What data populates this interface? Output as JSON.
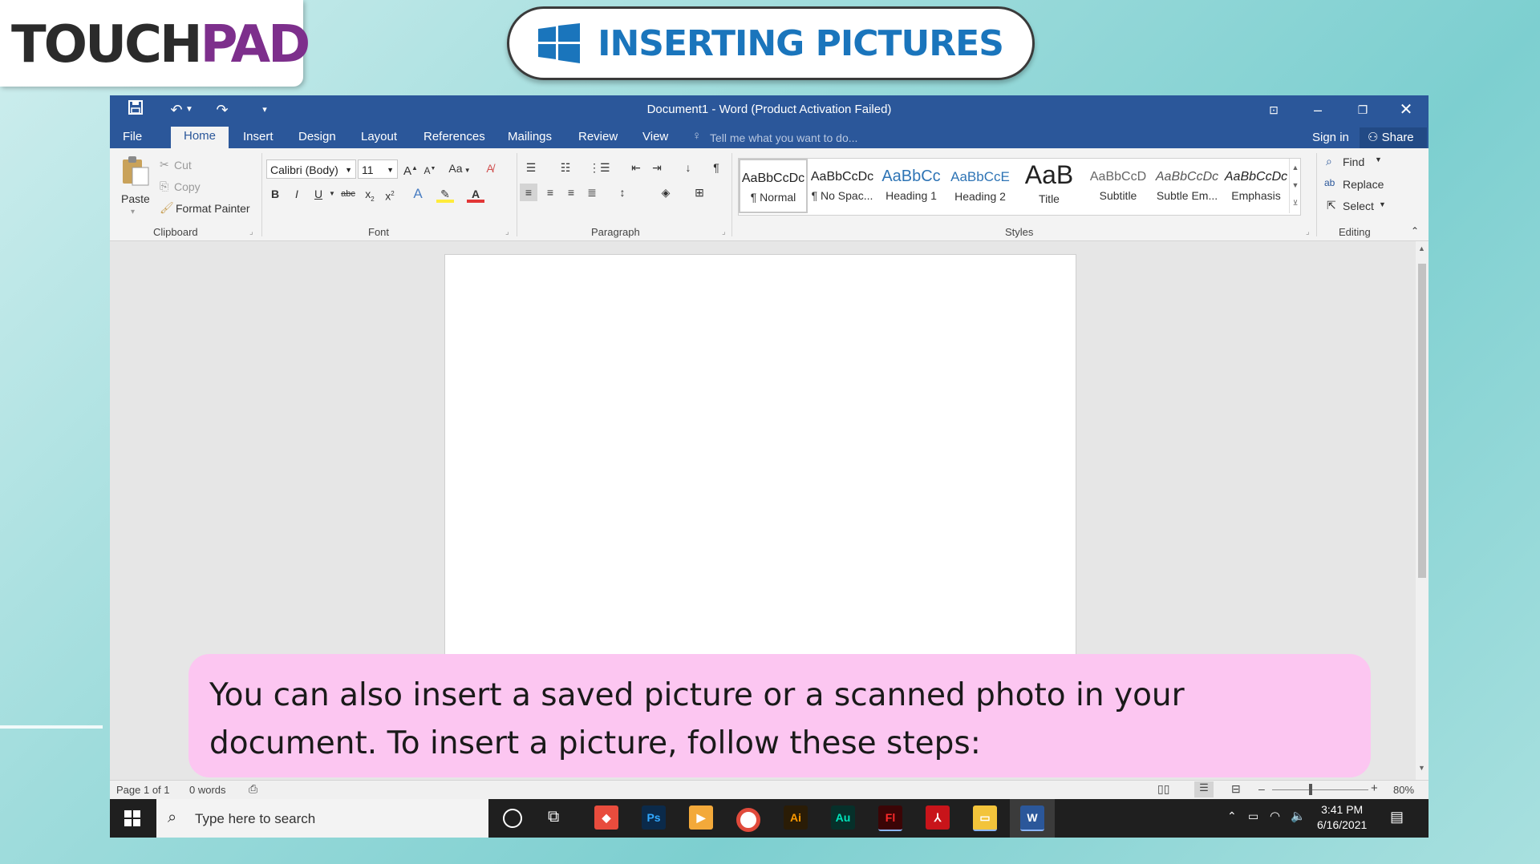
{
  "brand": {
    "part1": "TOUCH",
    "part2": "PAD"
  },
  "slide_title": "INSERTING PICTURES",
  "window": {
    "title": "Document1 - Word (Product Activation Failed)"
  },
  "tabs": [
    {
      "label": "File"
    },
    {
      "label": "Home"
    },
    {
      "label": "Insert"
    },
    {
      "label": "Design"
    },
    {
      "label": "Layout"
    },
    {
      "label": "References"
    },
    {
      "label": "Mailings"
    },
    {
      "label": "Review"
    },
    {
      "label": "View"
    }
  ],
  "tell_me": "Tell me what you want to do...",
  "sign_in": "Sign in",
  "share": "Share",
  "clipboard": {
    "paste": "Paste",
    "cut": "Cut",
    "copy": "Copy",
    "format_painter": "Format Painter",
    "label": "Clipboard"
  },
  "font": {
    "name": "Calibri (Body)",
    "size": "11",
    "case": "Aa",
    "label": "Font"
  },
  "paragraph": {
    "label": "Paragraph"
  },
  "styles": {
    "label": "Styles",
    "items": [
      {
        "preview": "AaBbCcDc",
        "label": "¶ Normal"
      },
      {
        "preview": "AaBbCcDc",
        "label": "¶ No Spac..."
      },
      {
        "preview": "AaBbCc",
        "label": "Heading 1"
      },
      {
        "preview": "AaBbCcE",
        "label": "Heading 2"
      },
      {
        "preview": "AaB",
        "label": "Title"
      },
      {
        "preview": "AaBbCcD",
        "label": "Subtitle"
      },
      {
        "preview": "AaBbCcDc",
        "label": "Subtle Em..."
      },
      {
        "preview": "AaBbCcDc",
        "label": "Emphasis"
      }
    ]
  },
  "editing": {
    "find": "Find",
    "replace": "Replace",
    "select": "Select",
    "label": "Editing"
  },
  "status": {
    "page": "Page 1 of 1",
    "words": "0 words",
    "zoom": "80%"
  },
  "taskbar": {
    "search_placeholder": "Type here to search",
    "time": "3:41 PM",
    "date": "6/16/2021"
  },
  "callout": "You can also insert a saved picture or a scanned photo in your document. To insert a picture, follow these steps:"
}
